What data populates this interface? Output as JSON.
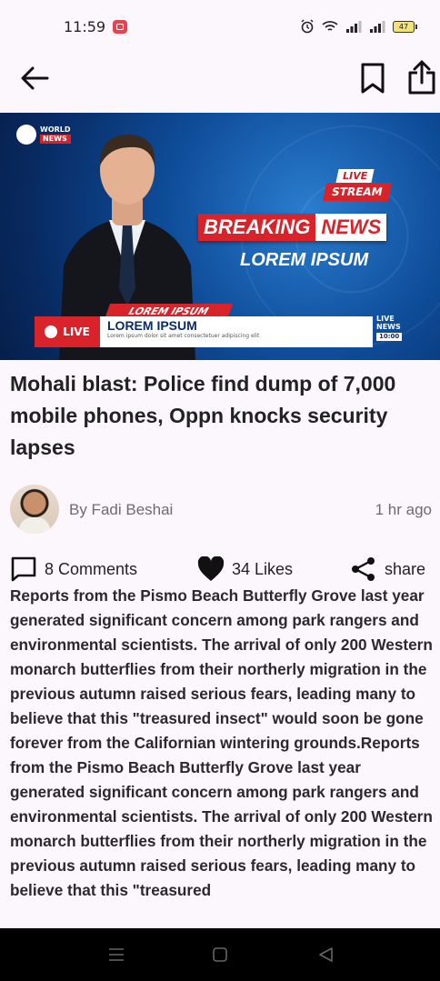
{
  "status_bar": {
    "time": "11:59",
    "battery": "47"
  },
  "hero": {
    "logo_top": "WORLD",
    "logo_bottom": "NEWS",
    "live_badge": "LIVE",
    "stream_badge": "STREAM",
    "breaking": "BREAKING",
    "news": "NEWS",
    "subtitle": "LOREM IPSUM",
    "lower_red": "LOREM IPSUM",
    "lower_live": "LIVE",
    "lower_title": "LOREM IPSUM",
    "lower_sub": "Lorem ipsum dolor sit amet consectetuer adipiscing elit",
    "side_live": "LIVE",
    "side_news": "NEWS",
    "side_time": "10:00"
  },
  "article": {
    "title": "Mohali blast: Police find dump of 7,000 mobile phones, Oppn knocks security lapses",
    "author": "By Fadi Beshai",
    "time_ago": "1 hr ago",
    "comments": "8 Comments",
    "likes": "34 Likes",
    "share": "share",
    "body": "Reports from the Pismo Beach Butterfly Grove last year generated significant concern among park rangers and environmental scientists. The arrival of only 200 Western monarch butterflies from their northerly migration in the previous autumn raised serious fears, leading many to believe that this \"treasured insect\" would soon be gone forever from the Californian wintering grounds.Reports from the Pismo Beach Butterfly Grove last year generated significant concern among park rangers and environmental scientists. The arrival of only 200 Western monarch butterflies from their northerly migration in the previous autumn raised serious fears, leading many to believe that this \"treasured"
  },
  "icons": {
    "back": "back-arrow-icon",
    "bookmark": "bookmark-icon",
    "share": "share-upload-icon",
    "comment": "comment-icon",
    "heart": "heart-icon",
    "share_nodes": "share-nodes-icon"
  },
  "colors": {
    "background": "#fcf7fd",
    "breaking_red": "#d8232a",
    "text": "#222222",
    "muted": "#6f6a72"
  }
}
